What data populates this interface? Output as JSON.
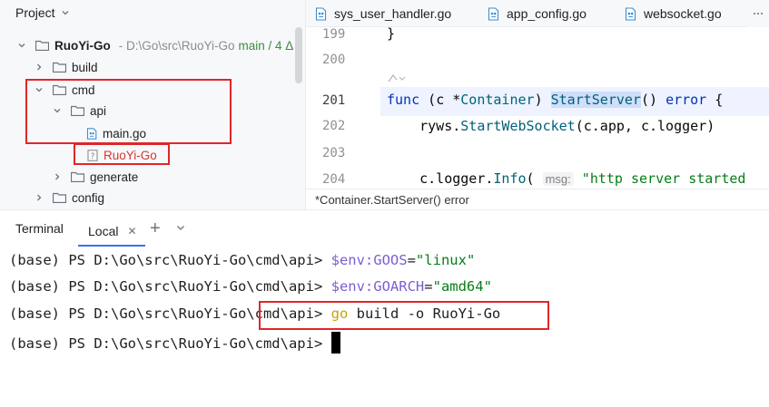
{
  "project": {
    "title": "Project",
    "root_name": "RuoYi-Go",
    "root_path": "D:\\Go\\src\\RuoYi-Go",
    "root_vcs": "main / 4 Δ",
    "items": [
      {
        "label": "build"
      },
      {
        "label": "cmd"
      },
      {
        "label": "api"
      },
      {
        "label": "main.go"
      },
      {
        "label": "RuoYi-Go"
      },
      {
        "label": "generate"
      },
      {
        "label": "config"
      }
    ]
  },
  "editor": {
    "tabs": [
      {
        "label": "sys_user_handler.go"
      },
      {
        "label": "app_config.go"
      },
      {
        "label": "websocket.go"
      }
    ],
    "lines": [
      {
        "num": "199",
        "code": "}"
      },
      {
        "num": "200",
        "code": ""
      },
      {
        "num": "201",
        "kw": "func",
        "open": " (",
        "recv": "c",
        "star": " *",
        "type": "Container",
        "close": ") ",
        "fn": "StartServer",
        "rest": "() ",
        "ret": "error",
        "tail": " {"
      },
      {
        "num": "202",
        "pre": "    ryws.",
        "fn": "StartWebSocket",
        "rest": "(c.app, c.logger)"
      },
      {
        "num": "203",
        "code": ""
      },
      {
        "num": "204",
        "pre": "    c.logger.",
        "fn": "Info",
        "open": "( ",
        "hint": "msg:",
        "str": " \"http server started"
      }
    ],
    "breadcrumb": "*Container.StartServer() error"
  },
  "terminal": {
    "title": "Terminal",
    "tab_label": "Local",
    "prompt": "(base) PS D:\\Go\\src\\RuoYi-Go\\cmd\\api> ",
    "lines": [
      {
        "var": "$env:GOOS",
        "eq": "=",
        "val": "\"linux\""
      },
      {
        "var": "$env:GOARCH",
        "eq": "=",
        "val": "\"amd64\""
      },
      {
        "cmd": "go",
        "args": " build -o RuoYi-Go"
      },
      {}
    ]
  }
}
